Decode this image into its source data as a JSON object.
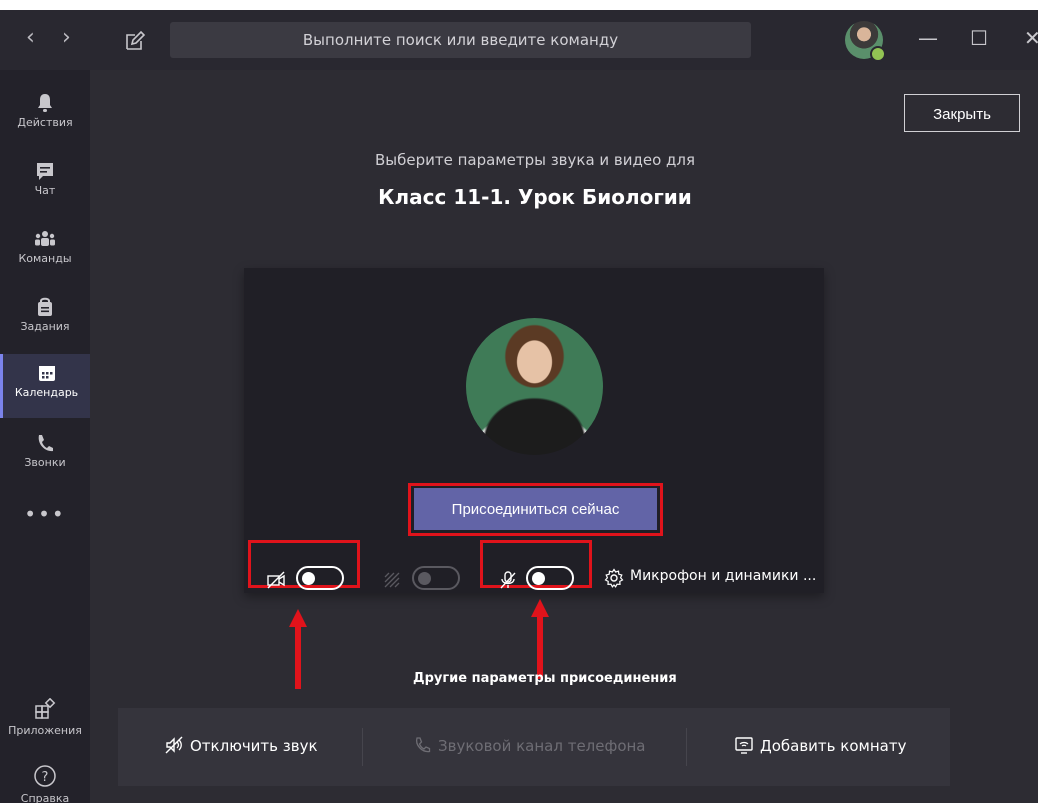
{
  "titlebar": {
    "back_glyph": "‹",
    "forward_glyph": "›",
    "search_placeholder": "Выполните поиск или введите команду",
    "minimize_glyph": "—",
    "maximize_glyph": "☐",
    "close_glyph": "✕"
  },
  "rail": {
    "items": [
      {
        "label": "Действия",
        "icon": "bell-icon"
      },
      {
        "label": "Чат",
        "icon": "chat-icon"
      },
      {
        "label": "Команды",
        "icon": "teams-icon"
      },
      {
        "label": "Задания",
        "icon": "assignments-icon"
      },
      {
        "label": "Календарь",
        "icon": "calendar-icon",
        "active": true
      },
      {
        "label": "Звонки",
        "icon": "phone-icon"
      }
    ],
    "more": "•••",
    "apps_label": "Приложения",
    "help_label": "Справка"
  },
  "main": {
    "close_label": "Закрыть",
    "subtitle": "Выберите параметры звука и видео для",
    "meeting_title": "Класс 11-1. Урок Биологии",
    "join_label": "Присоединиться сейчас",
    "device_label": "Микрофон и динамики ...",
    "other_params": "Другие параметры присоединения"
  },
  "bottom_options": {
    "mute_label": "Отключить звук",
    "phone_label": "Звуковой канал телефона",
    "room_label": "Добавить комнату"
  },
  "colors": {
    "accent": "#6264a7",
    "highlight": "#e0131b",
    "background": "#2d2c33"
  }
}
